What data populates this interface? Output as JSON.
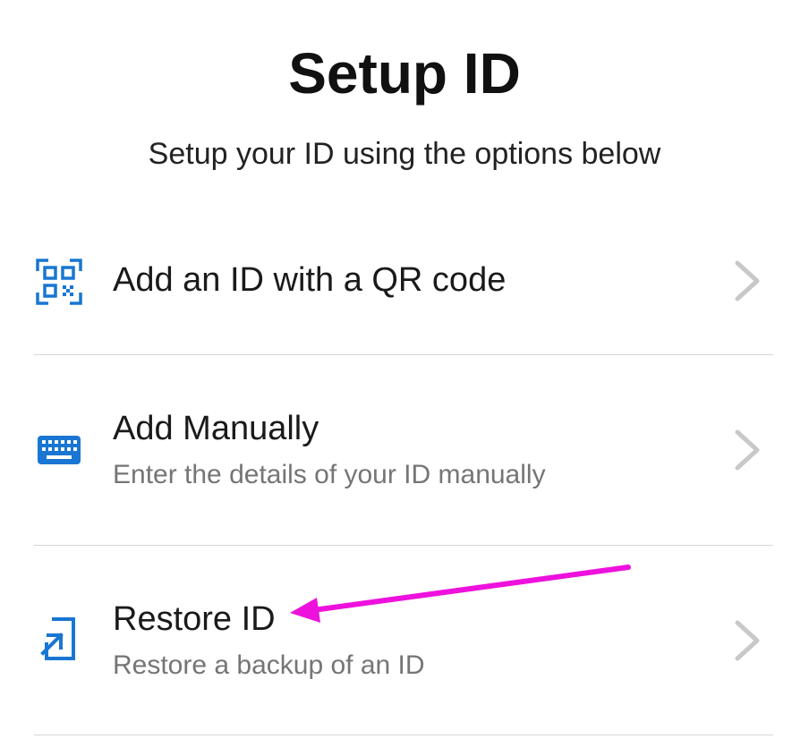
{
  "header": {
    "title": "Setup ID",
    "subtitle": "Setup your ID using the options below"
  },
  "options": [
    {
      "title": "Add an ID with a QR code",
      "description": "",
      "icon": "qr-code-icon"
    },
    {
      "title": "Add Manually",
      "description": "Enter the details of your ID manually",
      "icon": "keyboard-icon"
    },
    {
      "title": "Restore ID",
      "description": "Restore a backup of an ID",
      "icon": "restore-icon"
    }
  ],
  "colors": {
    "icon_accent": "#1976d2",
    "chevron": "#c8c8c8",
    "divider": "#d6d6d6",
    "annotation_arrow": "#ee11dd"
  }
}
